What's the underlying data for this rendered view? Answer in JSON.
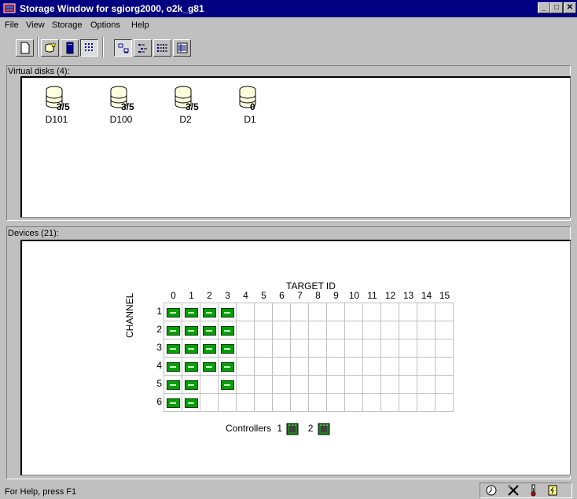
{
  "window": {
    "title": "Storage Window for sgiorg2000, o2k_g81",
    "min_label": "_",
    "max_label": "□",
    "close_label": "✕"
  },
  "menu": [
    {
      "label": "File"
    },
    {
      "label": "View"
    },
    {
      "label": "Storage"
    },
    {
      "label": "Options"
    },
    {
      "label": "Help"
    }
  ],
  "toolbar": [
    {
      "name": "new-document-icon"
    },
    {
      "name": "add-disk-icon"
    },
    {
      "name": "device-icon"
    },
    {
      "name": "grid-view-icon",
      "pressed": true
    },
    {
      "name": "large-icons-icon"
    },
    {
      "name": "small-icons-icon"
    },
    {
      "name": "list-icon"
    },
    {
      "name": "details-icon"
    }
  ],
  "virtual_disks": {
    "label": "Virtual disks (4):",
    "items": [
      {
        "name": "D101",
        "count": "3/5"
      },
      {
        "name": "D100",
        "count": "3/5"
      },
      {
        "name": "D2",
        "count": "3/5"
      },
      {
        "name": "D1",
        "count": "0"
      }
    ]
  },
  "devices": {
    "label": "Devices (21):",
    "target_id_label": "TARGET ID",
    "channel_label": "CHANNEL",
    "target_ids": [
      "0",
      "1",
      "2",
      "3",
      "4",
      "5",
      "6",
      "7",
      "8",
      "9",
      "10",
      "11",
      "12",
      "13",
      "14",
      "15"
    ],
    "channels": [
      {
        "id": "1",
        "occupied": [
          0,
          1,
          2,
          3
        ]
      },
      {
        "id": "2",
        "occupied": [
          0,
          1,
          2,
          3
        ]
      },
      {
        "id": "3",
        "occupied": [
          0,
          1,
          2,
          3
        ]
      },
      {
        "id": "4",
        "occupied": [
          0,
          1,
          2,
          3
        ]
      },
      {
        "id": "5",
        "occupied": [
          0,
          1,
          3
        ]
      },
      {
        "id": "6",
        "occupied": [
          0,
          1
        ]
      }
    ],
    "controllers_label": "Controllers",
    "controllers": [
      "1",
      "2"
    ]
  },
  "status": {
    "text": "For Help, press F1"
  },
  "colors": {
    "titlebar": "#000080",
    "device": "#00a000",
    "face": "#c0c0c0"
  }
}
